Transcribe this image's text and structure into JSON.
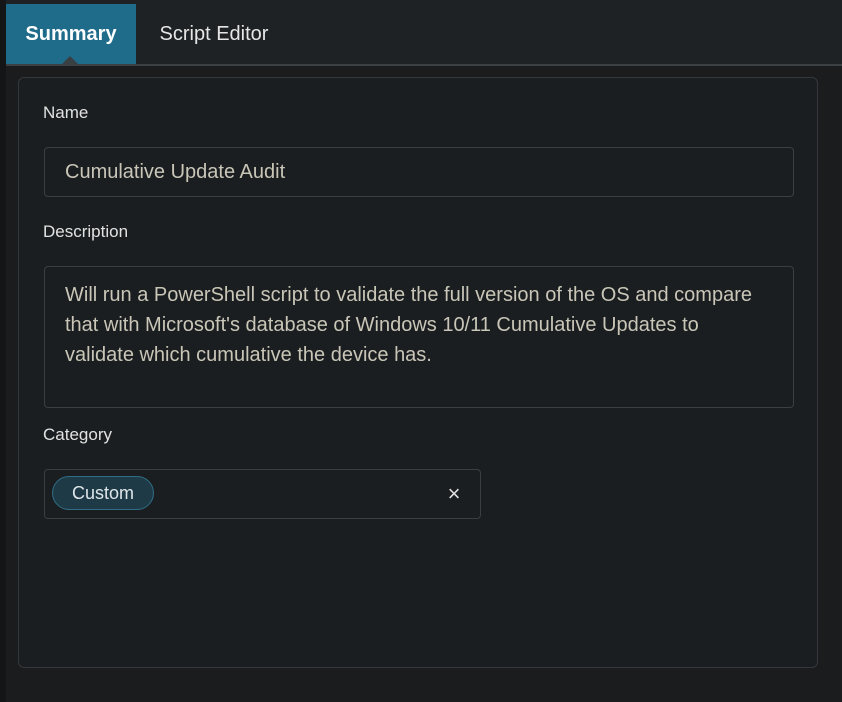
{
  "tabs": {
    "summary": "Summary",
    "script_editor": "Script Editor"
  },
  "form": {
    "name_label": "Name",
    "name_value": "Cumulative Update Audit",
    "description_label": "Description",
    "description_value": "Will run a PowerShell script to validate the full version of the OS and compare that with Microsoft's database of Windows 10/11 Cumulative Updates to validate which cumulative the device has.",
    "category_label": "Category",
    "category_chip": "Custom",
    "clear_icon": "×"
  },
  "colors": {
    "accent": "#1f6b8a",
    "background": "#1a1c1e",
    "chip_bg": "#1e3a47"
  }
}
